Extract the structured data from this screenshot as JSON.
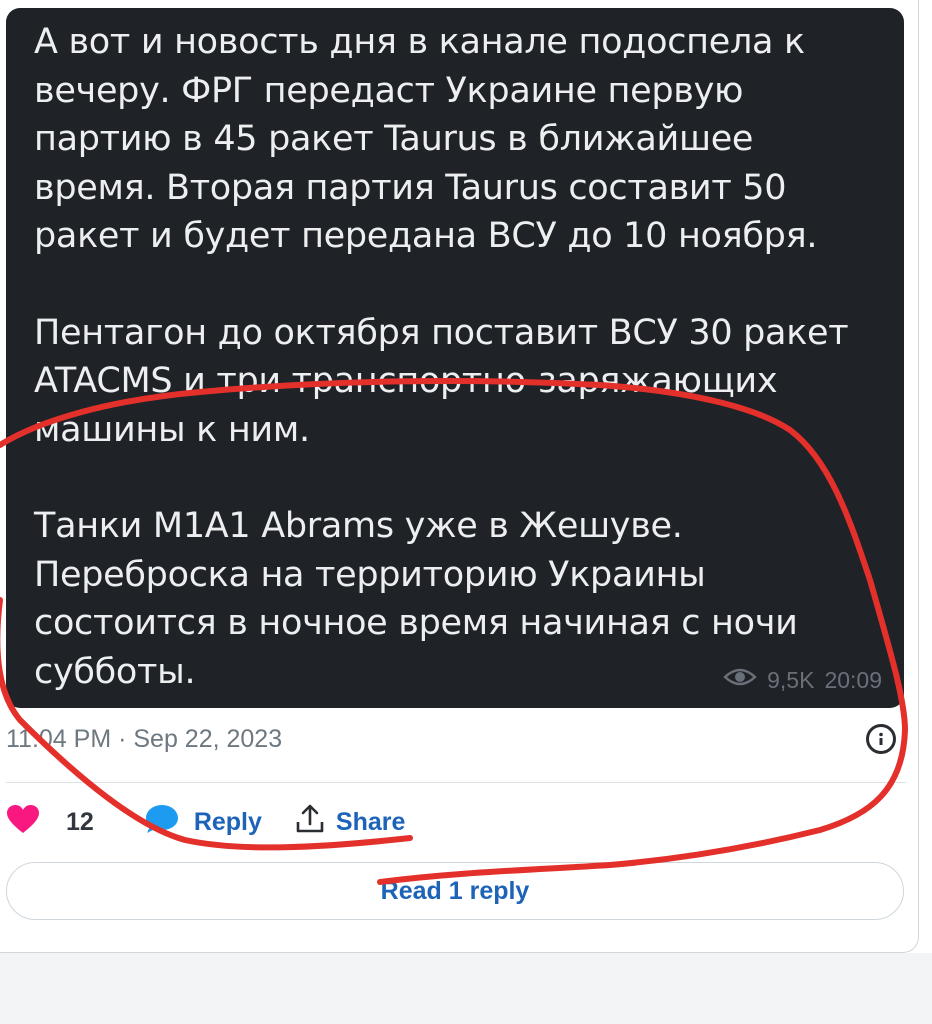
{
  "post": {
    "paragraphs": [
      "А вот и новость дня в канале подоспела к вечеру. ФРГ передаст Украине первую партию в 45 ракет Taurus в ближайшее время. Вторая партия Taurus составит 50 ракет и будет передана ВСУ до 10 ноября.",
      "Пентагон до октября поставит ВСУ 30 ракет ATACMS и три транспортно-заряжающих машины к ним.",
      "Танки M1A1 Abrams уже в Жешуве. Переброска на территорию Украины состоится в ночное время начиная с ночи субботы."
    ],
    "views": "9,5K",
    "time": "20:09"
  },
  "tweet": {
    "timestamp": "11:04 PM · Sep 22, 2023",
    "like_count": "12",
    "reply_label": "Reply",
    "share_label": "Share",
    "read_replies_label": "Read 1 reply",
    "icons": {
      "like": "heart-icon",
      "reply": "speech-bubble-icon",
      "share": "share-upload-icon",
      "more": "info-icon",
      "views": "eye-icon"
    }
  },
  "colors": {
    "post_background": "#1f2227",
    "heart": "#f91880",
    "link": "#1d63b8",
    "annotation": "#e3302b"
  }
}
